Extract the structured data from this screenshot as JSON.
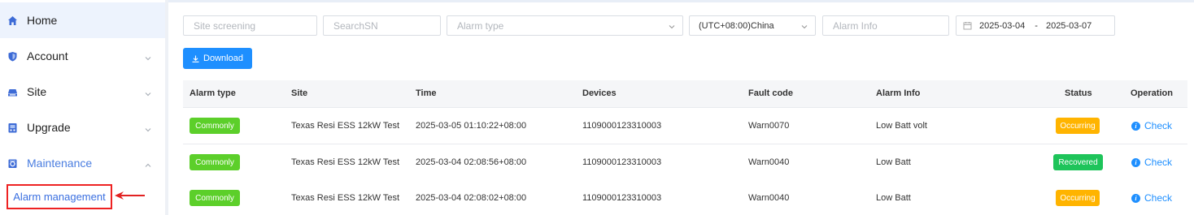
{
  "sidebar": {
    "items": [
      {
        "label": "Home",
        "icon": "home-icon"
      },
      {
        "label": "Account",
        "icon": "shield-icon"
      },
      {
        "label": "Site",
        "icon": "site-icon"
      },
      {
        "label": "Upgrade",
        "icon": "upgrade-icon"
      },
      {
        "label": "Maintenance",
        "icon": "maintenance-icon"
      }
    ],
    "sub_item": "Alarm management"
  },
  "filters": {
    "site_placeholder": "Site screening",
    "sn_placeholder": "SearchSN",
    "alarm_type_placeholder": "Alarm type",
    "timezone": "(UTC+08:00)China",
    "alarm_info_placeholder": "Alarm Info",
    "date_start": "2025-03-04",
    "date_sep": "-",
    "date_end": "2025-03-07"
  },
  "download_label": "Download",
  "table": {
    "columns": [
      "Alarm type",
      "Site",
      "Time",
      "Devices",
      "Fault code",
      "Alarm Info",
      "Status",
      "Operation"
    ],
    "rows": [
      {
        "type": "Commonly",
        "site": "Texas Resi ESS 12kW Test",
        "time": "2025-03-05 01:10:22+08:00",
        "device": "1109000123310003",
        "fault": "Warn0070",
        "info": "Low Batt volt",
        "status": "Occurring",
        "op": "Check"
      },
      {
        "type": "Commonly",
        "site": "Texas Resi ESS 12kW Test",
        "time": "2025-03-04 02:08:56+08:00",
        "device": "1109000123310003",
        "fault": "Warn0040",
        "info": "Low Batt",
        "status": "Recovered",
        "op": "Check"
      },
      {
        "type": "Commonly",
        "site": "Texas Resi ESS 12kW Test",
        "time": "2025-03-04 02:08:02+08:00",
        "device": "1109000123310003",
        "fault": "Warn0040",
        "info": "Low Batt",
        "status": "Occurring",
        "op": "Check"
      }
    ]
  },
  "colors": {
    "accent": "#1e8fff",
    "commonly": "#5ccf2a",
    "occurring": "#ffb400",
    "recovered": "#1ec45a",
    "highlight": "#e22222"
  }
}
